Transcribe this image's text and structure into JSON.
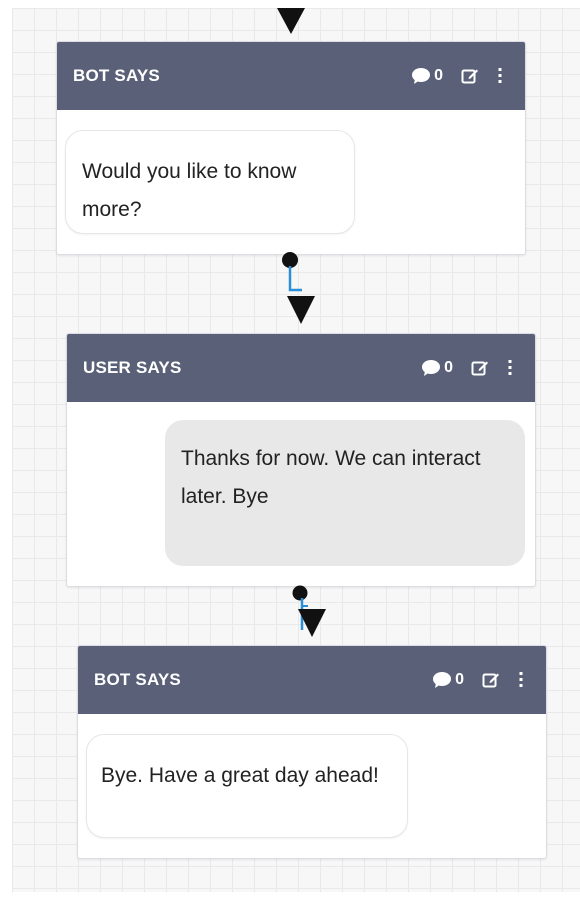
{
  "nodes": [
    {
      "title": "BOT SAYS",
      "comment_count": "0",
      "message": "Would you like to know more?",
      "role": "bot"
    },
    {
      "title": "USER SAYS",
      "comment_count": "0",
      "message": "Thanks for now. We can interact later. Bye",
      "role": "user"
    },
    {
      "title": "BOT SAYS",
      "comment_count": "0",
      "message": "Bye. Have a great day ahead!",
      "role": "bot"
    }
  ],
  "colors": {
    "header_bg": "#5a6077",
    "user_bubble_bg": "#e8e8e8",
    "connector_blue": "#2a8fd6",
    "arrow": "#111111"
  },
  "icons": {
    "comment": "comment-icon",
    "edit": "edit-icon",
    "menu": "kebab-menu-icon",
    "arrow": "arrow-down-icon",
    "port": "connector-port-icon"
  }
}
